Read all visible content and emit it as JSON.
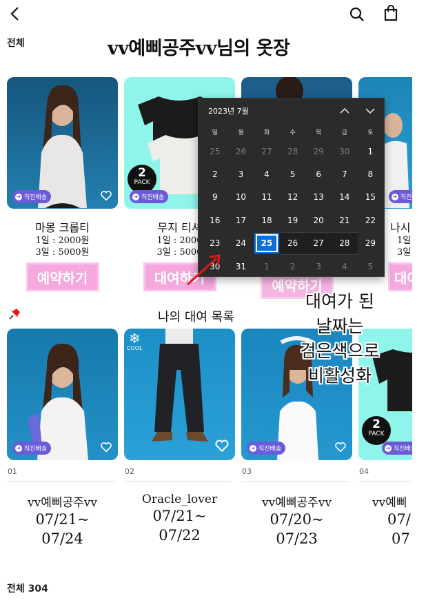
{
  "header": {
    "back_icon": "chevron-left-icon",
    "search_icon": "search-icon",
    "bag_icon": "shopping-bag-icon"
  },
  "wardrobe": {
    "filter_label": "전체",
    "title": "vv예삐공주vv님의 옷장"
  },
  "products": [
    {
      "name": "마몽 크롭티",
      "price_1day": "1일 : 2000원",
      "price_3day": "3일 : 5000원",
      "button": "예약하기",
      "badge": "직진배송",
      "pack": false
    },
    {
      "name": "무지 티셔",
      "price_1day": "1일 : 2000",
      "price_3day": "3일 : 5000",
      "button": "대여하기",
      "badge": "직진배송",
      "pack": true
    },
    {
      "name": "",
      "price_1day": "",
      "price_3day": "",
      "button": "예약하기",
      "badge": "",
      "pack": false
    },
    {
      "name": "나시",
      "price_1day": "1일",
      "price_3day": "3일",
      "button": "대여",
      "badge": "직진배송",
      "pack": false
    }
  ],
  "pack_badge": {
    "number": "2",
    "label": "PACK"
  },
  "cool_badge": "COOL",
  "rental": {
    "title": "나의 대여 목록",
    "pin_icon": "pushpin-icon",
    "items": [
      {
        "num": "01",
        "user": "vv예삐공주vv",
        "start": "07/21~",
        "end": "07/24",
        "badge": "직진배송"
      },
      {
        "num": "02",
        "user": "Oracle_lover",
        "start": "07/21~",
        "end": "07/22",
        "badge": ""
      },
      {
        "num": "03",
        "user": "vv예삐공주vv",
        "start": "07/20~",
        "end": "07/23",
        "badge": "직진배송"
      },
      {
        "num": "04",
        "user": "vv예삐",
        "start": "07/",
        "end": "07",
        "badge": "직진배송"
      }
    ]
  },
  "calendar": {
    "month_label": "2023년 7월",
    "weekdays": [
      "일",
      "월",
      "화",
      "수",
      "목",
      "금",
      "토"
    ],
    "weeks": [
      [
        {
          "d": "25",
          "s": "dim"
        },
        {
          "d": "26",
          "s": "dim"
        },
        {
          "d": "27",
          "s": "dim"
        },
        {
          "d": "28",
          "s": "dim"
        },
        {
          "d": "29",
          "s": "dim"
        },
        {
          "d": "30",
          "s": "dim"
        },
        {
          "d": "1",
          "s": ""
        }
      ],
      [
        {
          "d": "2",
          "s": ""
        },
        {
          "d": "3",
          "s": ""
        },
        {
          "d": "4",
          "s": ""
        },
        {
          "d": "5",
          "s": ""
        },
        {
          "d": "6",
          "s": ""
        },
        {
          "d": "7",
          "s": ""
        },
        {
          "d": "8",
          "s": ""
        }
      ],
      [
        {
          "d": "9",
          "s": ""
        },
        {
          "d": "10",
          "s": ""
        },
        {
          "d": "11",
          "s": ""
        },
        {
          "d": "12",
          "s": ""
        },
        {
          "d": "13",
          "s": ""
        },
        {
          "d": "14",
          "s": ""
        },
        {
          "d": "15",
          "s": ""
        }
      ],
      [
        {
          "d": "16",
          "s": ""
        },
        {
          "d": "17",
          "s": ""
        },
        {
          "d": "18",
          "s": ""
        },
        {
          "d": "19",
          "s": ""
        },
        {
          "d": "20",
          "s": ""
        },
        {
          "d": "21",
          "s": ""
        },
        {
          "d": "22",
          "s": ""
        }
      ],
      [
        {
          "d": "23",
          "s": ""
        },
        {
          "d": "24",
          "s": ""
        },
        {
          "d": "25",
          "s": "today"
        },
        {
          "d": "26",
          "s": "blocked"
        },
        {
          "d": "27",
          "s": "blocked"
        },
        {
          "d": "28",
          "s": "blocked"
        },
        {
          "d": "29",
          "s": ""
        }
      ],
      [
        {
          "d": "30",
          "s": ""
        },
        {
          "d": "31",
          "s": ""
        },
        {
          "d": "1",
          "s": "dim"
        },
        {
          "d": "2",
          "s": "dim"
        },
        {
          "d": "3",
          "s": "dim"
        },
        {
          "d": "4",
          "s": "dim"
        },
        {
          "d": "5",
          "s": "dim"
        }
      ]
    ]
  },
  "annotation": {
    "lines": [
      "대여가 된",
      "날짜는",
      "검은색으로",
      "비활성화"
    ]
  },
  "footer": {
    "total_label": "전체 304"
  },
  "colors": {
    "accent_pink": "#f4a8dd",
    "badge_purple": "#6b5bd6",
    "calendar_bg": "#2b2b2b",
    "today_blue": "#0a6fd6",
    "arrow_red": "#e0191b"
  }
}
